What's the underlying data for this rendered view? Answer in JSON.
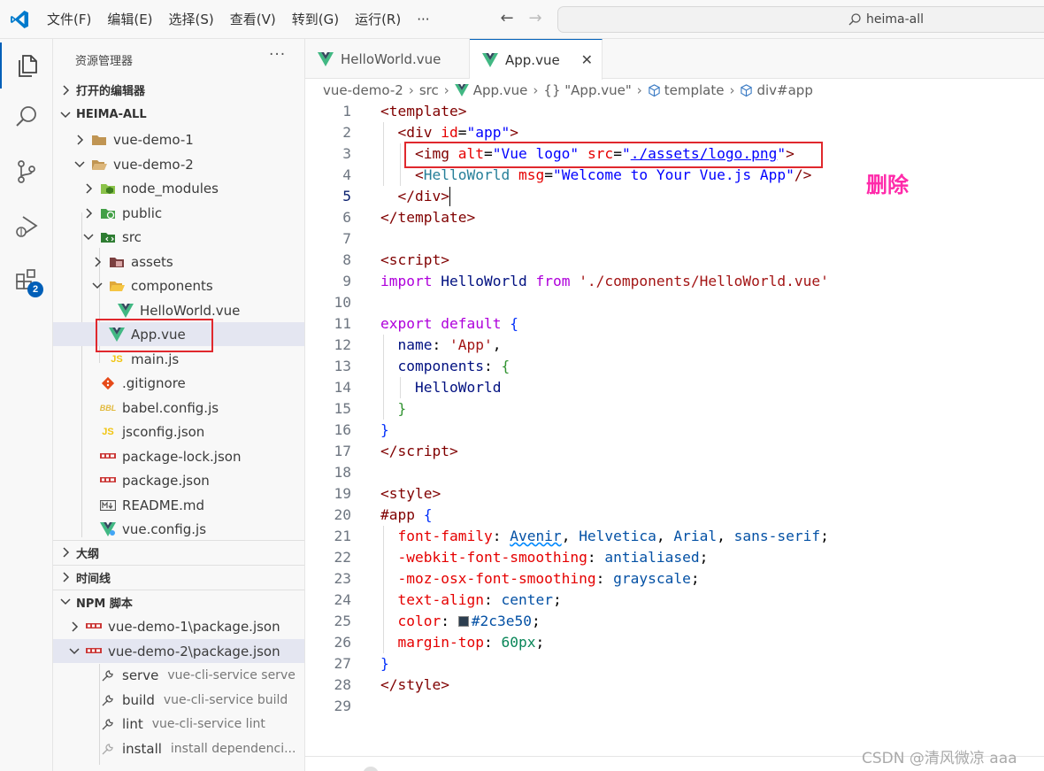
{
  "titlebar": {
    "menu": [
      "文件(F)",
      "编辑(E)",
      "选择(S)",
      "查看(V)",
      "转到(G)",
      "运行(R)",
      "···"
    ],
    "search": "heima-all"
  },
  "activity": {
    "extensions_badge": "2"
  },
  "sidebar": {
    "title": "资源管理器",
    "more": "···",
    "open_editors": "打开的编辑器",
    "root": "HEIMA-ALL",
    "tree": [
      "vue-demo-1",
      "vue-demo-2",
      "node_modules",
      "public",
      "src",
      "assets",
      "components",
      "HelloWorld.vue",
      "App.vue",
      "main.js",
      ".gitignore",
      "babel.config.js",
      "jsconfig.json",
      "package-lock.json",
      "package.json",
      "README.md",
      "vue.config.js"
    ],
    "outline": "大纲",
    "timeline": "时间线",
    "npm_scripts": "NPM 脚本",
    "npm_packages": [
      "vue-demo-1\\package.json",
      "vue-demo-2\\package.json"
    ],
    "scripts": [
      {
        "name": "serve",
        "cmd": "vue-cli-service serve"
      },
      {
        "name": "build",
        "cmd": "vue-cli-service build"
      },
      {
        "name": "lint",
        "cmd": "vue-cli-service lint"
      },
      {
        "name": "install",
        "cmd": "install dependenci..."
      }
    ]
  },
  "editor": {
    "tabs": [
      "HelloWorld.vue",
      "App.vue"
    ],
    "breadcrumb": [
      "vue-demo-2",
      "src",
      "App.vue",
      "{} \"App.vue\"",
      "template",
      "div#app"
    ],
    "line_numbers": [
      "1",
      "2",
      "3",
      "4",
      "5",
      "6",
      "7",
      "8",
      "9",
      "10",
      "11",
      "12",
      "13",
      "14",
      "15",
      "16",
      "17",
      "18",
      "19",
      "20",
      "21",
      "22",
      "23",
      "24",
      "25",
      "26",
      "27",
      "28",
      "29"
    ],
    "annotation": "删除",
    "watermark": "CSDN @清风微凉 aaa"
  },
  "colors": {
    "accent": "#005fb8",
    "vue_green": "#41b883",
    "vue_dark": "#35495e",
    "highlight_red": "#e0282d",
    "annotation_pink": "#ff2aaa"
  }
}
